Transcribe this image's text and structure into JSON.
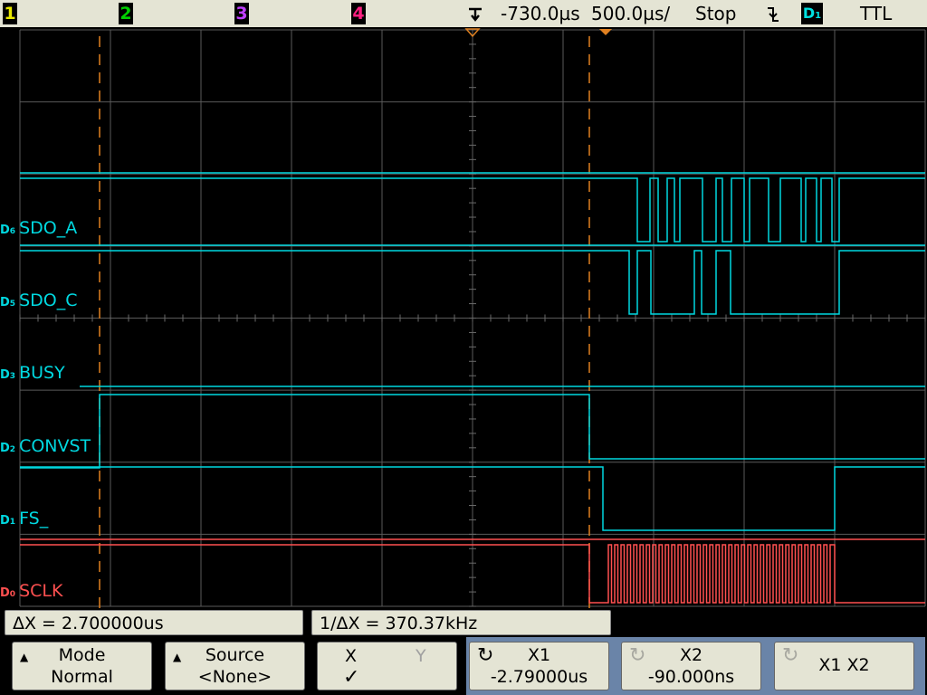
{
  "topbar": {
    "ch1": "1",
    "ch2": "2",
    "ch3": "3",
    "ch4": "4",
    "delay": "-730.0µs",
    "timebase": "500.0µs/",
    "run_state": "Stop",
    "trigger_source": "D1",
    "trigger_level": "TTL",
    "colors": {
      "ch1": "#e8e800",
      "ch2": "#00d000",
      "ch3": "#c040ff",
      "ch4": "#ff2080"
    }
  },
  "channels": [
    {
      "num": "6",
      "name": "SDO_A",
      "color": "#00d8e0"
    },
    {
      "num": "5",
      "name": "SDO_C",
      "color": "#00d8e0"
    },
    {
      "num": "3",
      "name": "BUSY",
      "color": "#00d8e0"
    },
    {
      "num": "2",
      "name": "CONVST",
      "color": "#00d8e0"
    },
    {
      "num": "1",
      "name": "FS_",
      "color": "#00d8e0"
    },
    {
      "num": "0",
      "name": "SCLK",
      "color": "#ff5050"
    }
  ],
  "measurements": {
    "delta_x": "ΔX = 2.700000us",
    "inv_delta_x": "1/ΔX = 370.37kHz"
  },
  "softkeys": {
    "mode": {
      "line1": "Mode",
      "line2": "Normal"
    },
    "source": {
      "line1": "Source",
      "line2": "<None>"
    },
    "xy": {
      "x": "X",
      "y": "Y",
      "check": "✓"
    },
    "x1": {
      "line1": "X1",
      "line2": "-2.79000us"
    },
    "x2": {
      "line1": "X2",
      "line2": "-90.000ns"
    },
    "x1x2": {
      "line1": "X1 X2"
    }
  }
}
